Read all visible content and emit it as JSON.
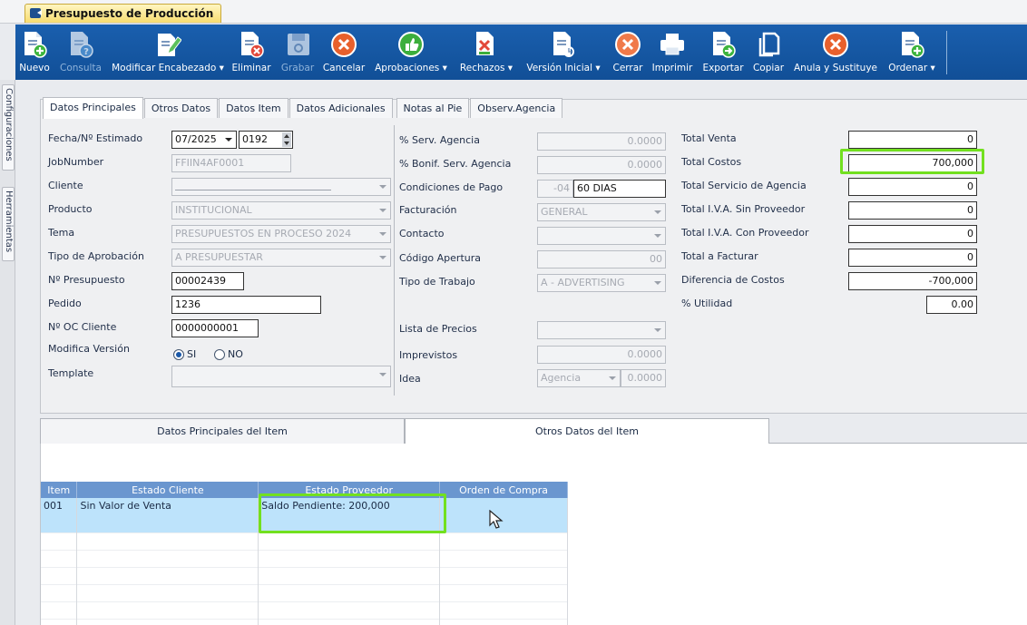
{
  "window": {
    "title": "Presupuesto de Producción"
  },
  "toolbar": {
    "buttons": [
      {
        "label": "Nuevo",
        "icon": "doc-plus-icon",
        "enabled": true
      },
      {
        "label": "Consulta",
        "icon": "doc-question-icon",
        "enabled": false
      },
      {
        "label": "Modificar Encabezado ▾",
        "icon": "doc-edit-icon",
        "enabled": true
      },
      {
        "label": "Eliminar",
        "icon": "doc-delete-icon",
        "enabled": true
      },
      {
        "label": "Grabar",
        "icon": "save-icon",
        "enabled": false
      },
      {
        "label": "Cancelar",
        "icon": "cancel-icon",
        "enabled": true
      },
      {
        "label": "Aprobaciones ▾",
        "icon": "thumbs-up-icon",
        "enabled": true
      },
      {
        "label": "Rechazos ▾",
        "icon": "doc-reject-icon",
        "enabled": true
      },
      {
        "label": "Versión Inicial ▾",
        "icon": "doc-version-icon",
        "enabled": true
      },
      {
        "label": "Cerrar",
        "icon": "close-icon",
        "enabled": true
      },
      {
        "label": "Imprimir",
        "icon": "printer-icon",
        "enabled": true
      },
      {
        "label": "Exportar",
        "icon": "export-icon",
        "enabled": true
      },
      {
        "label": "Copiar",
        "icon": "copy-icon",
        "enabled": true
      },
      {
        "label": "Anula y Sustituye",
        "icon": "annul-icon",
        "enabled": true
      },
      {
        "label": "Ordenar ▾",
        "icon": "order-icon",
        "enabled": true
      }
    ]
  },
  "sidetabs": {
    "config": "Configuraciones",
    "tools": "Herramientas"
  },
  "tabs": [
    "Datos Principales",
    "Otros Datos",
    "Datos Item",
    "Datos Adicionales",
    "Notas al Pie",
    "Observ.Agencia"
  ],
  "left_form": {
    "fecha_label": "Fecha/Nº Estimado",
    "fecha_value": "07/2025",
    "estimado_value": "0192",
    "jobnumber_label": "JobNumber",
    "jobnumber_value": "FFIIN4AF0001",
    "cliente_label": "Cliente",
    "cliente_value": "",
    "producto_label": "Producto",
    "producto_value": "INSTITUCIONAL",
    "tema_label": "Tema",
    "tema_value": "PRESUPUESTOS EN PROCESO 2024",
    "tipo_aprob_label": "Tipo de Aprobación",
    "tipo_aprob_value": "A PRESUPUESTAR",
    "presupuesto_label": "Nº Presupuesto",
    "presupuesto_value": "00002439",
    "pedido_label": "Pedido",
    "pedido_value": "1236",
    "oc_label": "Nº OC Cliente",
    "oc_value": "0000000001",
    "modifica_label": "Modifica Versión",
    "si_label": "SI",
    "no_label": "NO",
    "template_label": "Template",
    "template_value": ""
  },
  "mid_form": {
    "serv_label": "% Serv. Agencia",
    "serv_value": "0.0000",
    "bonif_label": "% Bonif. Serv. Agencia",
    "bonif_value": "0.0000",
    "condiciones_label": "Condiciones de Pago",
    "condiciones_code": "-04",
    "condiciones_value": "60 DIAS",
    "facturacion_label": "Facturación",
    "facturacion_value": "GENERAL",
    "contacto_label": "Contacto",
    "contacto_value": "",
    "codigo_label": "Código Apertura",
    "codigo_value": "00",
    "tipo_trabajo_label": "Tipo de Trabajo",
    "tipo_trabajo_value": "A - ADVERTISING",
    "lista_label": "Lista de Precios",
    "lista_value": "",
    "imprevistos_label": "Imprevistos",
    "imprevistos_value": "0.0000",
    "idea_label": "Idea",
    "idea_value": "Agencia",
    "idea_num": "0.0000"
  },
  "totals": {
    "venta_label": "Total Venta",
    "venta_value": "0",
    "costos_label": "Total Costos",
    "costos_value": "700,000",
    "servicio_label": "Total Servicio de Agencia",
    "servicio_value": "0",
    "iva_sin_label": "Total I.V.A. Sin Proveedor",
    "iva_sin_value": "0",
    "iva_con_label": "Total I.V.A. Con Proveedor",
    "iva_con_value": "0",
    "facturar_label": "Total a Facturar",
    "facturar_value": "0",
    "diferencia_label": "Diferencia de Costos",
    "diferencia_value": "-700,000",
    "utilidad_label": "% Utilidad",
    "utilidad_value": "0.00"
  },
  "lower_tabs": [
    "Datos Principales del Item",
    "Otros Datos del Item"
  ],
  "grid": {
    "headers": [
      "Item",
      "Estado Cliente",
      "Estado Proveedor",
      "Orden de Compra"
    ],
    "rows": [
      {
        "item": "001",
        "estado_cliente": "Sin Valor de Venta",
        "estado_proveedor": "Saldo Pendiente: 200,000",
        "orden": ""
      }
    ]
  },
  "colors": {
    "toolbar": "#1a5fae",
    "grid_header": "#6a96cf",
    "selected_row": "#bde3fb",
    "highlight": "#72e01f"
  }
}
